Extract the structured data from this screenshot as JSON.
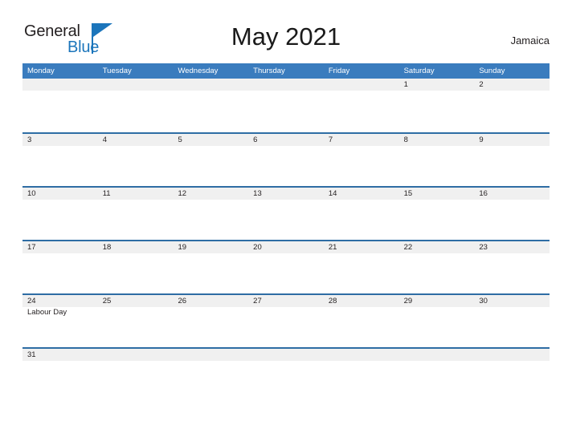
{
  "brand": {
    "name_part1": "General",
    "name_part2": "Blue",
    "flag_icon": "blue-flag-triangle",
    "color_dark": "#231f20",
    "color_blue": "#1b75bb"
  },
  "header": {
    "title": "May 2021",
    "locale": "Jamaica"
  },
  "colors": {
    "header_bar": "#3a7cbe",
    "week_divider": "#2e6da4",
    "date_band": "#f0f0f0",
    "page_background": "#ffffff",
    "text": "#231f20"
  },
  "calendar": {
    "month": "May",
    "year": "2021",
    "weekday_headers": [
      "Monday",
      "Tuesday",
      "Wednesday",
      "Thursday",
      "Friday",
      "Saturday",
      "Sunday"
    ],
    "weeks": [
      {
        "days": [
          {
            "date": "",
            "event": ""
          },
          {
            "date": "",
            "event": ""
          },
          {
            "date": "",
            "event": ""
          },
          {
            "date": "",
            "event": ""
          },
          {
            "date": "",
            "event": ""
          },
          {
            "date": "1",
            "event": ""
          },
          {
            "date": "2",
            "event": ""
          }
        ]
      },
      {
        "days": [
          {
            "date": "3",
            "event": ""
          },
          {
            "date": "4",
            "event": ""
          },
          {
            "date": "5",
            "event": ""
          },
          {
            "date": "6",
            "event": ""
          },
          {
            "date": "7",
            "event": ""
          },
          {
            "date": "8",
            "event": ""
          },
          {
            "date": "9",
            "event": ""
          }
        ]
      },
      {
        "days": [
          {
            "date": "10",
            "event": ""
          },
          {
            "date": "11",
            "event": ""
          },
          {
            "date": "12",
            "event": ""
          },
          {
            "date": "13",
            "event": ""
          },
          {
            "date": "14",
            "event": ""
          },
          {
            "date": "15",
            "event": ""
          },
          {
            "date": "16",
            "event": ""
          }
        ]
      },
      {
        "days": [
          {
            "date": "17",
            "event": ""
          },
          {
            "date": "18",
            "event": ""
          },
          {
            "date": "19",
            "event": ""
          },
          {
            "date": "20",
            "event": ""
          },
          {
            "date": "21",
            "event": ""
          },
          {
            "date": "22",
            "event": ""
          },
          {
            "date": "23",
            "event": ""
          }
        ]
      },
      {
        "days": [
          {
            "date": "24",
            "event": "Labour Day"
          },
          {
            "date": "25",
            "event": ""
          },
          {
            "date": "26",
            "event": ""
          },
          {
            "date": "27",
            "event": ""
          },
          {
            "date": "28",
            "event": ""
          },
          {
            "date": "29",
            "event": ""
          },
          {
            "date": "30",
            "event": ""
          }
        ]
      },
      {
        "days": [
          {
            "date": "31",
            "event": ""
          },
          {
            "date": "",
            "event": ""
          },
          {
            "date": "",
            "event": ""
          },
          {
            "date": "",
            "event": ""
          },
          {
            "date": "",
            "event": ""
          },
          {
            "date": "",
            "event": ""
          },
          {
            "date": "",
            "event": ""
          }
        ]
      }
    ]
  }
}
